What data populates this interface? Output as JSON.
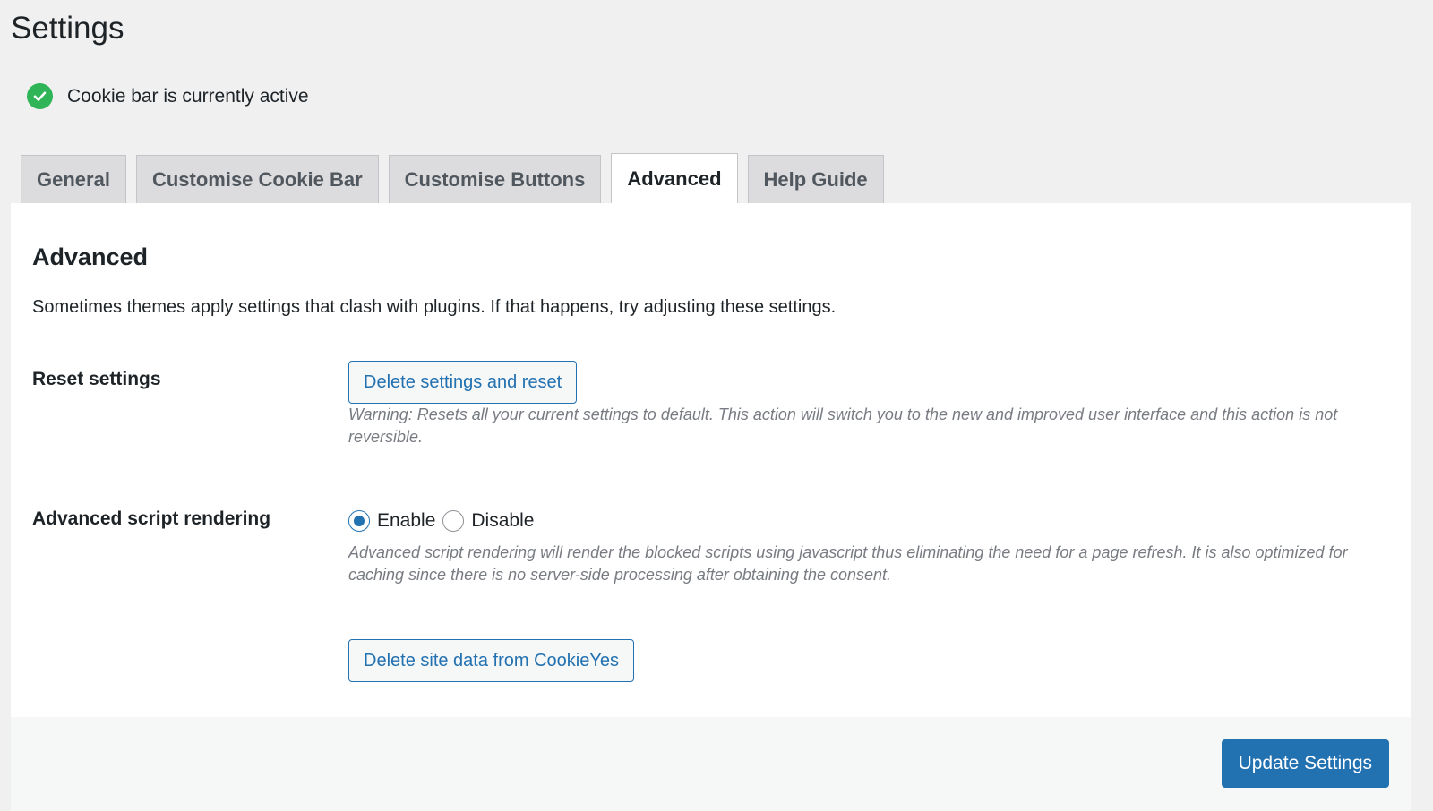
{
  "page": {
    "title": "Settings"
  },
  "status": {
    "icon": "check-circle-icon",
    "text": "Cookie bar is currently active",
    "color": "#2fb457"
  },
  "tabs": [
    {
      "label": "General",
      "active": false
    },
    {
      "label": "Customise Cookie Bar",
      "active": false
    },
    {
      "label": "Customise Buttons",
      "active": false
    },
    {
      "label": "Advanced",
      "active": true
    },
    {
      "label": "Help Guide",
      "active": false
    }
  ],
  "panel": {
    "heading": "Advanced",
    "description": "Sometimes themes apply settings that clash with plugins. If that happens, try adjusting these settings.",
    "reset": {
      "label": "Reset settings",
      "button_label": "Delete settings and reset",
      "help": "Warning: Resets all your current settings to default. This action will switch you to the new and improved user interface and this action is not reversible."
    },
    "script_rendering": {
      "label": "Advanced script rendering",
      "options": [
        {
          "label": "Enable",
          "selected": true
        },
        {
          "label": "Disable",
          "selected": false
        }
      ],
      "help": "Advanced script rendering will render the blocked scripts using javascript thus eliminating the need for a page refresh. It is also optimized for caching since there is no server-side processing after obtaining the consent."
    },
    "delete_site_data_label": "Delete site data from CookieYes"
  },
  "footer": {
    "update_label": "Update Settings"
  },
  "colors": {
    "accent": "#2271b1",
    "background": "#f0f0f1"
  }
}
